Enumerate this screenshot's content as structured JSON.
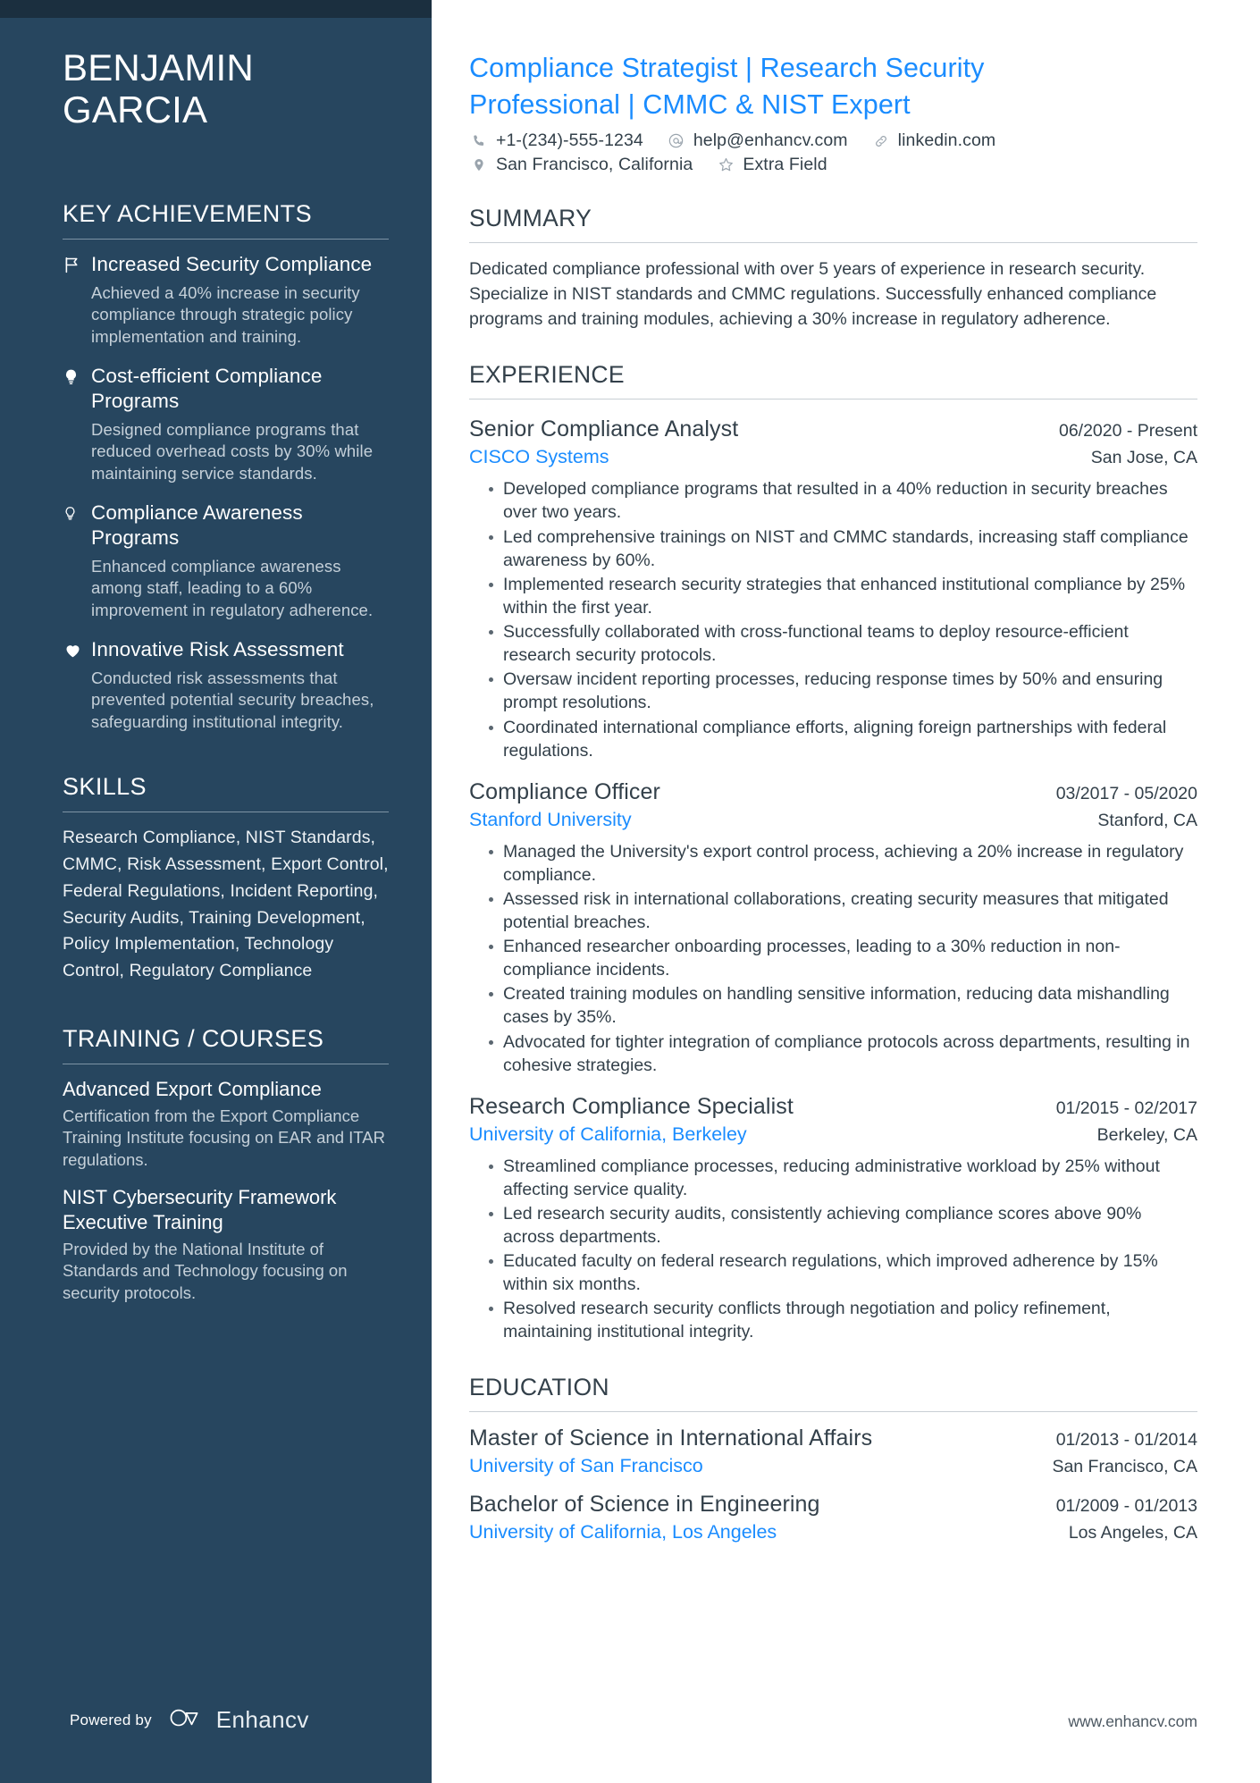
{
  "theme": {
    "sidebar_bg": "#27465f",
    "sidebar_topbar": "#1b2f3f",
    "accent_blue": "#1a8cff",
    "text_dark": "#33404a",
    "sidebar_muted": "#c5d0d9"
  },
  "sidebar": {
    "name": "BENJAMIN GARCIA",
    "name_line1": "BENJAMIN",
    "name_line2": "GARCIA",
    "achievements_heading": "KEY ACHIEVEMENTS",
    "achievements": [
      {
        "icon": "flag-icon",
        "title": "Increased Security Compliance",
        "description": "Achieved a 40% increase in security compliance through strategic policy implementation and training."
      },
      {
        "icon": "lightbulb-filled-icon",
        "title": "Cost-efficient Compliance Programs",
        "description": "Designed compliance programs that reduced overhead costs by 30% while maintaining service standards."
      },
      {
        "icon": "lightbulb-outline-icon",
        "title": "Compliance Awareness Programs",
        "description": "Enhanced compliance awareness among staff, leading to a 60% improvement in regulatory adherence."
      },
      {
        "icon": "heart-icon",
        "title": "Innovative Risk Assessment",
        "description": "Conducted risk assessments that prevented potential security breaches, safeguarding institutional integrity."
      }
    ],
    "skills_heading": "SKILLS",
    "skills_text": "Research Compliance, NIST Standards, CMMC, Risk Assessment, Export Control, Federal Regulations, Incident Reporting, Security Audits, Training Development, Policy Implementation, Technology Control, Regulatory Compliance",
    "training_heading": "TRAINING / COURSES",
    "courses": [
      {
        "title": "Advanced Export Compliance",
        "description": "Certification from the Export Compliance Training Institute focusing on EAR and ITAR regulations."
      },
      {
        "title": "NIST Cybersecurity Framework Executive Training",
        "description": "Provided by the National Institute of Standards and Technology focusing on security protocols."
      }
    ],
    "powered_by_label": "Powered by",
    "brand_name": "Enhancv"
  },
  "header": {
    "headline_line1": "Compliance Strategist | Research Security",
    "headline_line2": "Professional | CMMC & NIST Expert",
    "contacts_row1": [
      {
        "icon": "phone-icon",
        "text": "+1-(234)-555-1234"
      },
      {
        "icon": "at-email-icon",
        "text": "help@enhancv.com"
      },
      {
        "icon": "link-icon",
        "text": "linkedin.com"
      }
    ],
    "contacts_row2": [
      {
        "icon": "location-pin-icon",
        "text": "San Francisco, California"
      },
      {
        "icon": "star-outline-icon",
        "text": "Extra Field"
      }
    ]
  },
  "summary": {
    "heading": "SUMMARY",
    "text": "Dedicated compliance professional with over 5 years of experience in research security. Specialize in NIST standards and CMMC regulations. Successfully enhanced compliance programs and training modules, achieving a 30% increase in regulatory adherence."
  },
  "experience": {
    "heading": "EXPERIENCE",
    "entries": [
      {
        "title": "Senior Compliance Analyst",
        "date": "06/2020 - Present",
        "organization": "CISCO Systems",
        "location": "San Jose, CA",
        "bullets": [
          "Developed compliance programs that resulted in a 40% reduction in security breaches over two years.",
          "Led comprehensive trainings on NIST and CMMC standards, increasing staff compliance awareness by 60%.",
          "Implemented research security strategies that enhanced institutional compliance by 25% within the first year.",
          "Successfully collaborated with cross-functional teams to deploy resource-efficient research security protocols.",
          "Oversaw incident reporting processes, reducing response times by 50% and ensuring prompt resolutions.",
          "Coordinated international compliance efforts, aligning foreign partnerships with federal regulations."
        ]
      },
      {
        "title": "Compliance Officer",
        "date": "03/2017 - 05/2020",
        "organization": "Stanford University",
        "location": "Stanford, CA",
        "bullets": [
          "Managed the University's export control process, achieving a 20% increase in regulatory compliance.",
          "Assessed risk in international collaborations, creating security measures that mitigated potential breaches.",
          "Enhanced researcher onboarding processes, leading to a 30% reduction in non-compliance incidents.",
          "Created training modules on handling sensitive information, reducing data mishandling cases by 35%.",
          "Advocated for tighter integration of compliance protocols across departments, resulting in cohesive strategies."
        ]
      },
      {
        "title": "Research Compliance Specialist",
        "date": "01/2015 - 02/2017",
        "organization": "University of California, Berkeley",
        "location": "Berkeley, CA",
        "bullets": [
          "Streamlined compliance processes, reducing administrative workload by 25% without affecting service quality.",
          "Led research security audits, consistently achieving compliance scores above 90% across departments.",
          "Educated faculty on federal research regulations, which improved adherence by 15% within six months.",
          "Resolved research security conflicts through negotiation and policy refinement, maintaining institutional integrity."
        ]
      }
    ]
  },
  "education": {
    "heading": "EDUCATION",
    "entries": [
      {
        "degree": "Master of Science in International Affairs",
        "date": "01/2013 - 01/2014",
        "school": "University of San Francisco",
        "location": "San Francisco, CA"
      },
      {
        "degree": "Bachelor of Science in Engineering",
        "date": "01/2009 - 01/2013",
        "school": "University of California, Los Angeles",
        "location": "Los Angeles, CA"
      }
    ]
  },
  "footer": {
    "website": "www.enhancv.com"
  }
}
